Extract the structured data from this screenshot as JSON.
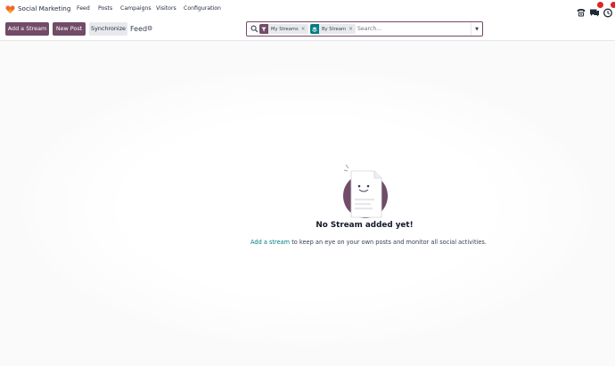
{
  "navbar": {
    "app_name": "Social Marketing",
    "menu": [
      "Feed",
      "Posts",
      "Campaigns",
      "Visitors",
      "Configuration"
    ],
    "icons": [
      "phone-icon",
      "chat-icon",
      "activity-icon"
    ],
    "badges": {
      "chat": "",
      "activity": ""
    }
  },
  "controls": {
    "add_stream_label": "Add a Stream",
    "new_post_label": "New Post",
    "synchronize_label": "Synchronize",
    "breadcrumb": "Feed",
    "gear_icon": "gear-icon"
  },
  "search": {
    "facets": [
      {
        "label": "My Streams",
        "icon": "filter-icon",
        "color": "#714b67"
      },
      {
        "label": "By Stream",
        "icon": "group-by-icon",
        "color": "#017e84"
      }
    ],
    "placeholder": "Search..."
  },
  "empty_state": {
    "title": "No Stream added yet!",
    "link_text": "Add a stream",
    "text": " to keep an eye on your own posts and monitor all social activities."
  },
  "colors": {
    "primary": "#714b67",
    "accent": "#017e84",
    "badge": "#dc2626"
  }
}
